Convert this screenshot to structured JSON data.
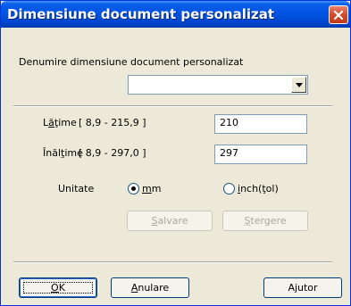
{
  "window": {
    "title": "Dimensiune document personalizat"
  },
  "name_section": {
    "label": "Denumire dimensiune document personalizat",
    "combo_value": ""
  },
  "width": {
    "label_pre": "L",
    "label_ul": "ă",
    "label_post": "ţime",
    "range": "[  8,9  -  215,9 ]",
    "value": "210"
  },
  "height": {
    "label_pre": "Înăl",
    "label_ul": "ţ",
    "label_post": "ime",
    "range": "[  8,9  -  297,0 ]",
    "value": "297"
  },
  "unit": {
    "label": "Unitate",
    "options": [
      {
        "pre": "",
        "ul": "m",
        "post": "m",
        "selected": true
      },
      {
        "pre": "",
        "ul": "i",
        "post": "nch(ţol)",
        "selected": false
      }
    ]
  },
  "actions": {
    "save": {
      "ul": "S",
      "post": "alvare"
    },
    "delete": {
      "ul": "Ş",
      "post": "tergere"
    }
  },
  "footer": {
    "ok": {
      "ul": "O",
      "post": "K"
    },
    "cancel": {
      "ul": "A",
      "post": "nulare"
    },
    "help": "Ajutor"
  }
}
